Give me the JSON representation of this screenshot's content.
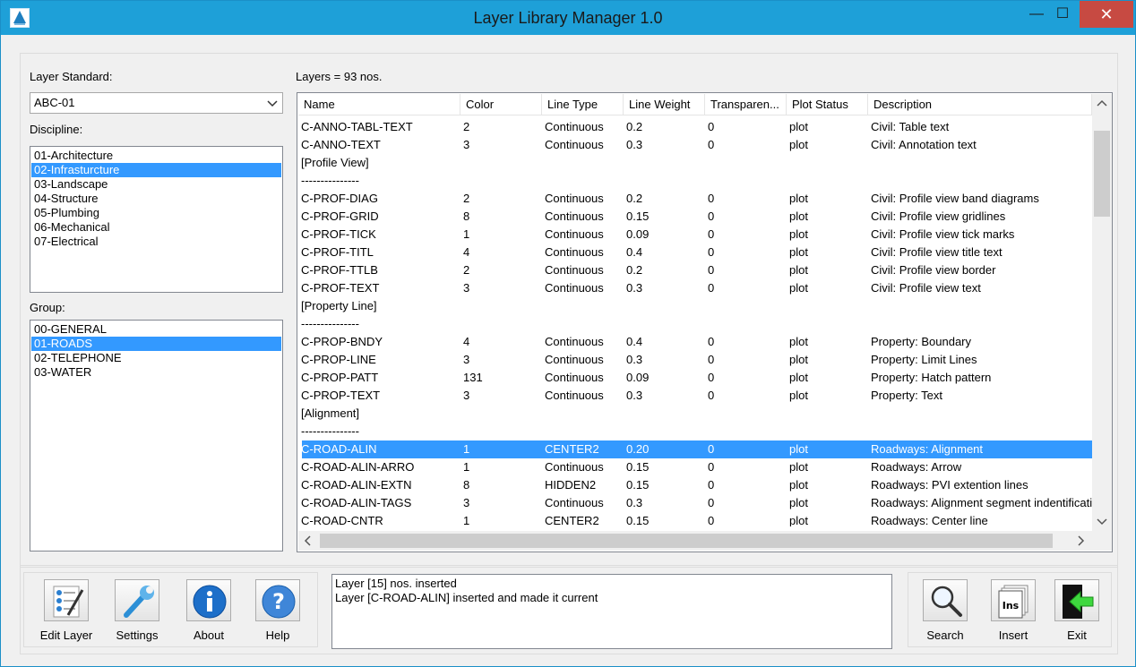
{
  "window": {
    "title": "Layer Library Manager 1.0",
    "minimize_glyph": "—",
    "maximize_glyph": "☐",
    "close_glyph": "✕"
  },
  "left_panel": {
    "layer_standard_label": "Layer Standard:",
    "layer_standard_value": "ABC-01",
    "discipline_label": "Discipline:",
    "disciplines": [
      "01-Architecture",
      "02-Infrasturcture",
      "03-Landscape",
      "04-Structure",
      "05-Plumbing",
      "06-Mechanical",
      "07-Electrical"
    ],
    "discipline_selected": 1,
    "group_label": "Group:",
    "groups": [
      "00-GENERAL",
      "01-ROADS",
      "02-TELEPHONE",
      "03-WATER"
    ],
    "group_selected": 1
  },
  "layers": {
    "count_label": "Layers = 93 nos.",
    "columns": [
      "Name",
      "Color",
      "Line Type",
      "Line Weight",
      "Transparen...",
      "Plot Status",
      "Description"
    ],
    "selected_row": 18,
    "rows": [
      [
        "C-ANNO-TABL-TEXT",
        "2",
        "Continuous",
        "0.2",
        "0",
        "plot",
        "Civil: Table text"
      ],
      [
        "C-ANNO-TEXT",
        "3",
        "Continuous",
        "0.3",
        "0",
        "plot",
        "Civil: Annotation text"
      ],
      [
        "[Profile View]",
        "",
        "",
        "",
        "",
        "",
        ""
      ],
      [
        "---------------",
        "",
        "",
        "",
        "",
        "",
        ""
      ],
      [
        "C-PROF-DIAG",
        "2",
        "Continuous",
        "0.2",
        "0",
        "plot",
        "Civil: Profile view band diagrams"
      ],
      [
        "C-PROF-GRID",
        "8",
        "Continuous",
        "0.15",
        "0",
        "plot",
        "Civil: Profile view gridlines"
      ],
      [
        "C-PROF-TICK",
        "1",
        "Continuous",
        "0.09",
        "0",
        "plot",
        "Civil: Profile view tick marks"
      ],
      [
        "C-PROF-TITL",
        "4",
        "Continuous",
        "0.4",
        "0",
        "plot",
        "Civil:  Profile view title text"
      ],
      [
        "C-PROF-TTLB",
        "2",
        "Continuous",
        "0.2",
        "0",
        "plot",
        "Civil:  Profile view border"
      ],
      [
        "C-PROF-TEXT",
        "3",
        "Continuous",
        "0.3",
        "0",
        "plot",
        "Civil:  Profile view text"
      ],
      [
        "[Property Line]",
        "",
        "",
        "",
        "",
        "",
        ""
      ],
      [
        "---------------",
        "",
        "",
        "",
        "",
        "",
        ""
      ],
      [
        "C-PROP-BNDY",
        "4",
        "Continuous",
        "0.4",
        "0",
        "plot",
        "Property: Boundary"
      ],
      [
        "C-PROP-LINE",
        "3",
        "Continuous",
        "0.3",
        "0",
        "plot",
        "Property: Limit Lines"
      ],
      [
        "C-PROP-PATT",
        "131",
        "Continuous",
        "0.09",
        "0",
        "plot",
        "Property: Hatch pattern"
      ],
      [
        "C-PROP-TEXT",
        "3",
        "Continuous",
        "0.3",
        "0",
        "plot",
        "Property:  Text"
      ],
      [
        "[Alignment]",
        "",
        "",
        "",
        "",
        "",
        ""
      ],
      [
        "---------------",
        "",
        "",
        "",
        "",
        "",
        ""
      ],
      [
        "C-ROAD-ALIN",
        "1",
        "CENTER2",
        "0.20",
        "0",
        "plot",
        "Roadways: Alignment"
      ],
      [
        "C-ROAD-ALIN-ARRO",
        "1",
        "Continuous",
        "0.15",
        "0",
        "plot",
        "Roadways:  Arrow"
      ],
      [
        "C-ROAD-ALIN-EXTN",
        "8",
        "HIDDEN2",
        "0.15",
        "0",
        "plot",
        "Roadways:  PVI extention lines"
      ],
      [
        "C-ROAD-ALIN-TAGS",
        "3",
        "Continuous",
        "0.3",
        "0",
        "plot",
        "Roadways: Alignment segment indentification"
      ],
      [
        "C-ROAD-CNTR",
        "1",
        "CENTER2",
        "0.15",
        "0",
        "plot",
        "Roadways: Center line"
      ]
    ]
  },
  "log": {
    "lines": [
      "Layer [15] nos. inserted",
      "Layer [C-ROAD-ALIN] inserted and made it current"
    ]
  },
  "toolbar_left": {
    "edit_layer": "Edit Layer",
    "settings": "Settings",
    "about": "About",
    "help": "Help"
  },
  "toolbar_right": {
    "search": "Search",
    "insert": "Insert",
    "exit": "Exit",
    "insert_icon_text": "Ins"
  },
  "colors": {
    "titlebar": "#1ea0d8",
    "selection": "#3399ff",
    "close_button": "#c74a42"
  }
}
